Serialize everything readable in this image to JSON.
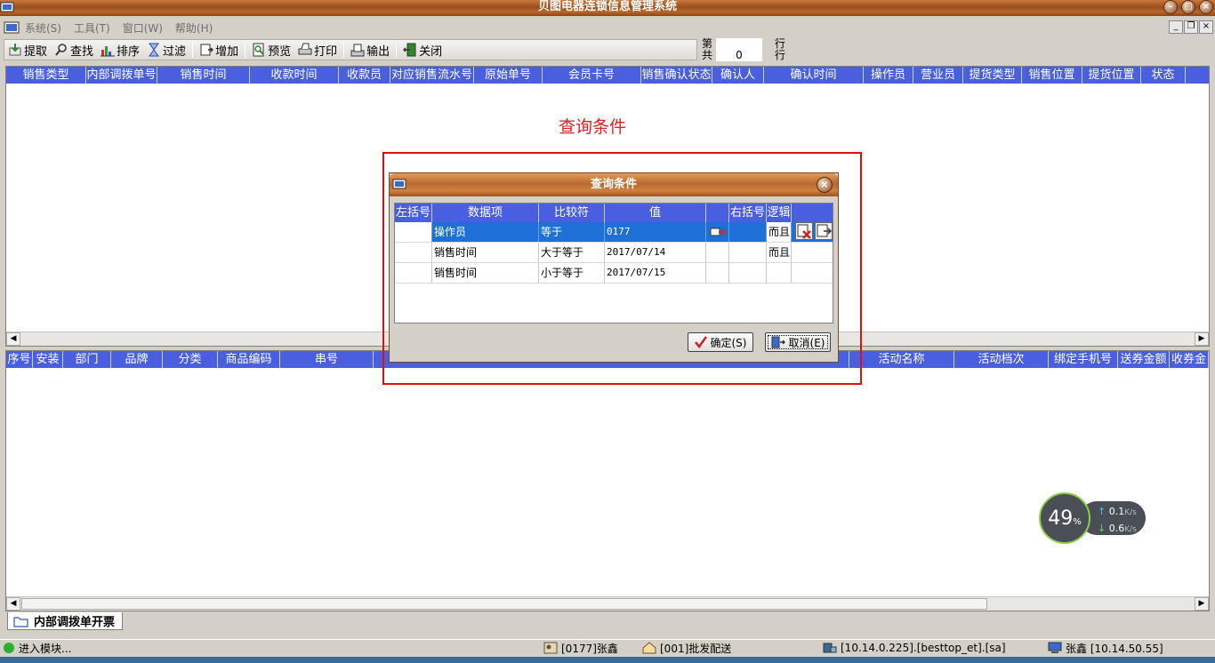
{
  "window": {
    "title": "贝图电器连锁信息管理系统"
  },
  "menu": [
    "系统(S)",
    "工具(T)",
    "窗口(W)",
    "帮助(H)"
  ],
  "toolbar": [
    "提取",
    "查找",
    "排序",
    "过滤",
    "增加",
    "预览",
    "打印",
    "输出",
    "关闭"
  ],
  "row_info": {
    "label1": "第",
    "label1b": "行",
    "label2": "共",
    "count": "0",
    "label2b": "行"
  },
  "top_grid": {
    "columns": [
      "销售类型",
      "内部调拨单号",
      "销售时间",
      "收款时间",
      "收款员",
      "对应销售流水号",
      "原始单号",
      "会员卡号",
      "销售确认状态",
      "确认人",
      "确认时间",
      "操作员",
      "营业员",
      "提货类型",
      "销售位置",
      "提货位置",
      "状态"
    ]
  },
  "bottom_grid": {
    "columns_left": [
      "序号",
      "安装",
      "部门",
      "品牌",
      "分类",
      "商品编码",
      "串号"
    ],
    "columns_right": [
      "活动名称",
      "活动档次",
      "绑定手机号",
      "送券金额",
      "收券金"
    ]
  },
  "annotation": "查询条件",
  "dialog": {
    "title": "查询条件",
    "columns": [
      "左括号",
      "数据项",
      "比较符",
      "值",
      "",
      "右括号",
      "逻辑"
    ],
    "rows": [
      {
        "left": "",
        "field": "操作员",
        "op": "等于",
        "value": "0177",
        "right": "",
        "logic": "而且"
      },
      {
        "left": "",
        "field": "销售时间",
        "op": "大于等于",
        "value": "2017/07/14",
        "right": "",
        "logic": "而且"
      },
      {
        "left": "",
        "field": "销售时间",
        "op": "小于等于",
        "value": "2017/07/15",
        "right": "",
        "logic": ""
      }
    ],
    "ok_label": "确定(S)",
    "cancel_label": "取消(E)"
  },
  "tab": {
    "label": "内部调拨单开票"
  },
  "status": {
    "message": "进入模块...",
    "user": "[0177]张鑫",
    "store": "[001]批发配送",
    "db": "[10.14.0.225].[besttop_et].[sa]",
    "host": "张鑫 [10.14.50.55]"
  },
  "net_widget": {
    "percent": "49",
    "percent_unit": "%",
    "up": "0.1",
    "down": "0.6",
    "unit": "K/s"
  }
}
